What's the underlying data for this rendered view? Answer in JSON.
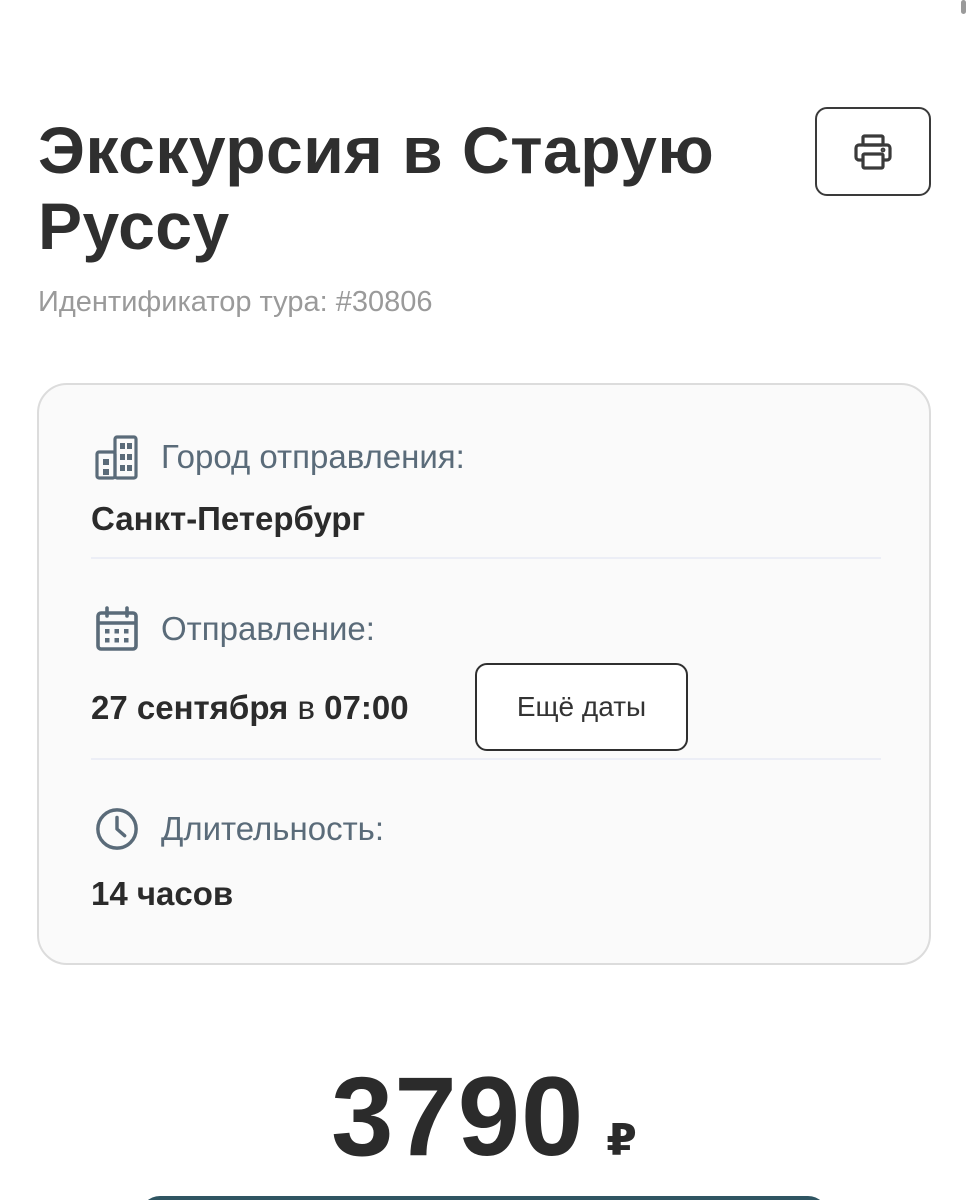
{
  "tour": {
    "title": "Экскурсия в Старую Руссу",
    "id_text": "Идентификатор тура: #30806"
  },
  "details": {
    "departure_city": {
      "icon": "building-icon",
      "label": "Город отправления:",
      "value": "Санкт-Петербург"
    },
    "departure": {
      "icon": "calendar-icon",
      "label": "Отправление:",
      "date": "27 сентября",
      "connector": "в",
      "time": "07:00",
      "more_dates_label": "Ещё даты"
    },
    "duration": {
      "icon": "clock-icon",
      "label": "Длительность:",
      "value": "14 часов"
    }
  },
  "price": {
    "amount": "3790",
    "currency": "₽"
  },
  "colors": {
    "accent": "#2f5562",
    "label": "#5a6b79",
    "muted": "#9a9a9a"
  }
}
